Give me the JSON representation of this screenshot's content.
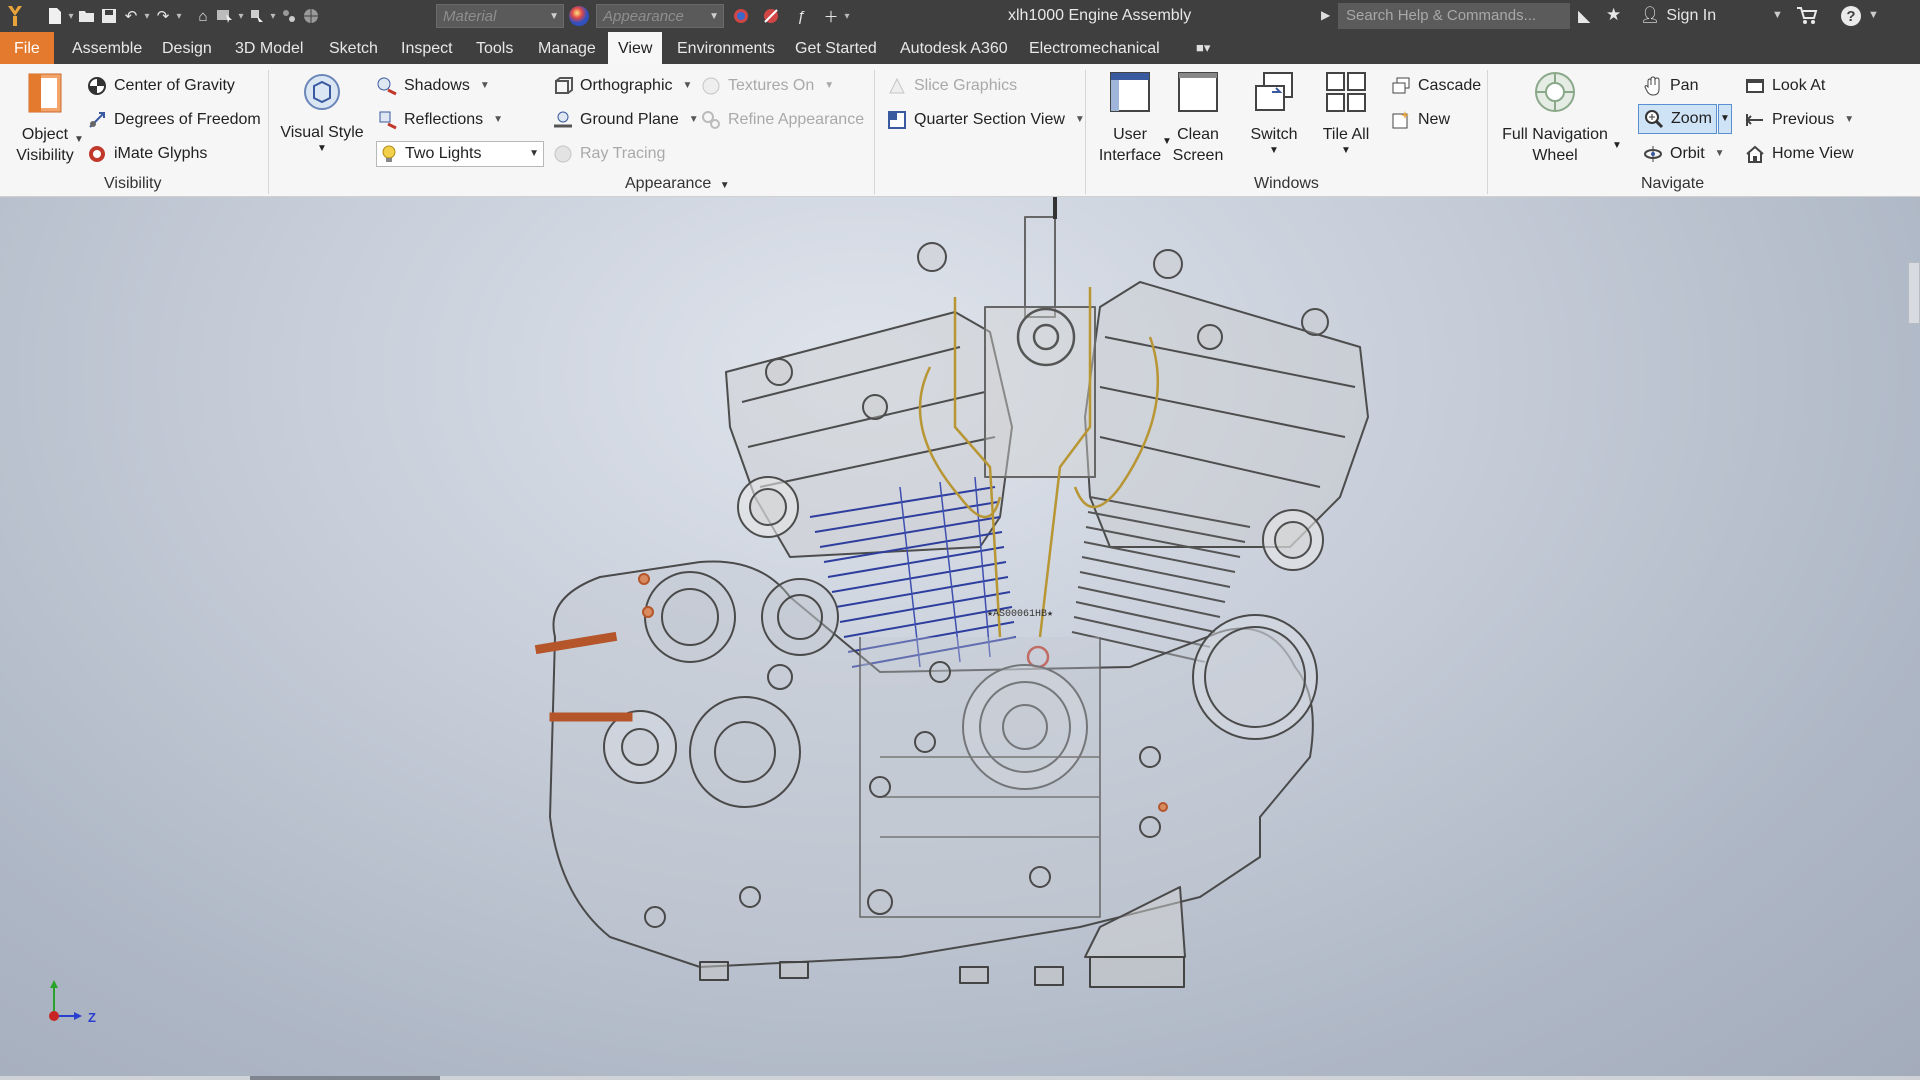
{
  "app": {
    "document_title": "xlh1000 Engine Assembly",
    "material_placeholder": "Material",
    "appearance_placeholder": "Appearance",
    "search_placeholder": "Search Help & Commands...",
    "signin_label": "Sign In"
  },
  "tabs": [
    "File",
    "Assemble",
    "Design",
    "3D Model",
    "Sketch",
    "Inspect",
    "Tools",
    "Manage",
    "View",
    "Environments",
    "Get Started",
    "Autodesk A360",
    "Electromechanical"
  ],
  "active_tab": "View",
  "ribbon": {
    "visibility": {
      "title": "Visibility",
      "object_visibility": "Object Visibility",
      "center_of_gravity": "Center of Gravity",
      "degrees_of_freedom": "Degrees of Freedom",
      "imate_glyphs": "iMate Glyphs"
    },
    "appearance": {
      "title": "Appearance",
      "visual_style": "Visual Style",
      "shadows": "Shadows",
      "reflections": "Reflections",
      "lighting_value": "Two Lights",
      "orthographic": "Orthographic",
      "ground_plane": "Ground Plane",
      "ray_tracing": "Ray Tracing",
      "textures_on": "Textures On",
      "refine_appearance": "Refine Appearance",
      "slice_graphics": "Slice Graphics",
      "quarter_section_view": "Quarter Section View"
    },
    "windows": {
      "title": "Windows",
      "user_interface": "User Interface",
      "clean_screen": "Clean Screen",
      "switch": "Switch",
      "tile_all": "Tile All",
      "cascade": "Cascade",
      "new": "New"
    },
    "navigate": {
      "title": "Navigate",
      "full_navigation_wheel": "Full Navigation Wheel",
      "pan": "Pan",
      "zoom": "Zoom",
      "orbit": "Orbit",
      "look_at": "Look At",
      "previous": "Previous",
      "home_view": "Home View"
    }
  },
  "viewport": {
    "serial_text": "★AS00061HB★",
    "axis_label": "Z"
  },
  "colors": {
    "orange_accent": "#e37a2d",
    "titlebar": "#3f3f3f",
    "wire_dark": "#555555",
    "wire_blue": "#2e3e9e",
    "wire_gold": "#c7a43a",
    "rust": "#b5552a"
  }
}
